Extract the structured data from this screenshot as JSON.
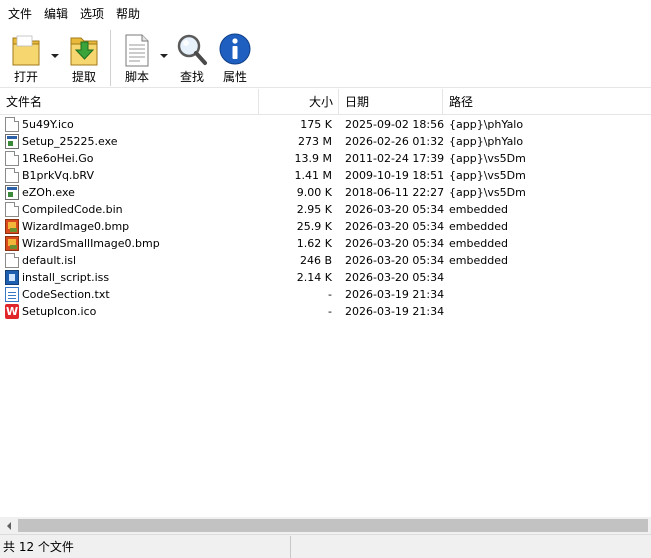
{
  "menu": [
    "文件",
    "编辑",
    "选项",
    "帮助"
  ],
  "toolbar": {
    "open_label": "打开",
    "extract_label": "提取",
    "script_label": "脚本",
    "find_label": "查找",
    "properties_label": "属性"
  },
  "columns": {
    "name": "文件名",
    "size": "大小",
    "date": "日期",
    "path": "路径"
  },
  "files": [
    {
      "name": "5u49Y.ico",
      "size": "175 K",
      "date": "2025-09-02 18:56",
      "path": "{app}\\phYalo",
      "icon": "doc"
    },
    {
      "name": "Setup_25225.exe",
      "size": "273 M",
      "date": "2026-02-26 01:32",
      "path": "{app}\\phYalo",
      "icon": "exe"
    },
    {
      "name": "1Re6oHei.Go",
      "size": "13.9 M",
      "date": "2011-02-24 17:39",
      "path": "{app}\\vs5Dm",
      "icon": "doc"
    },
    {
      "name": "B1prkVq.bRV",
      "size": "1.41 M",
      "date": "2009-10-19 18:51",
      "path": "{app}\\vs5Dm",
      "icon": "doc"
    },
    {
      "name": "eZOh.exe",
      "size": "9.00 K",
      "date": "2018-06-11 22:27",
      "path": "{app}\\vs5Dm",
      "icon": "exe"
    },
    {
      "name": "CompiledCode.bin",
      "size": "2.95 K",
      "date": "2026-03-20 05:34",
      "path": "embedded",
      "icon": "doc"
    },
    {
      "name": "WizardImage0.bmp",
      "size": "25.9 K",
      "date": "2026-03-20 05:34",
      "path": "embedded",
      "icon": "bmp"
    },
    {
      "name": "WizardSmallImage0.bmp",
      "size": "1.62 K",
      "date": "2026-03-20 05:34",
      "path": "embedded",
      "icon": "bmp"
    },
    {
      "name": "default.isl",
      "size": "246 B",
      "date": "2026-03-20 05:34",
      "path": "embedded",
      "icon": "doc"
    },
    {
      "name": "install_script.iss",
      "size": "2.14 K",
      "date": "2026-03-20 05:34",
      "path": "",
      "icon": "iss"
    },
    {
      "name": "CodeSection.txt",
      "size": "-",
      "date": "2026-03-19 21:34",
      "path": "",
      "icon": "txt"
    },
    {
      "name": "SetupIcon.ico",
      "size": "-",
      "date": "2026-03-19 21:34",
      "path": "",
      "icon": "ico"
    }
  ],
  "status": {
    "summary": "共 12 个文件"
  }
}
